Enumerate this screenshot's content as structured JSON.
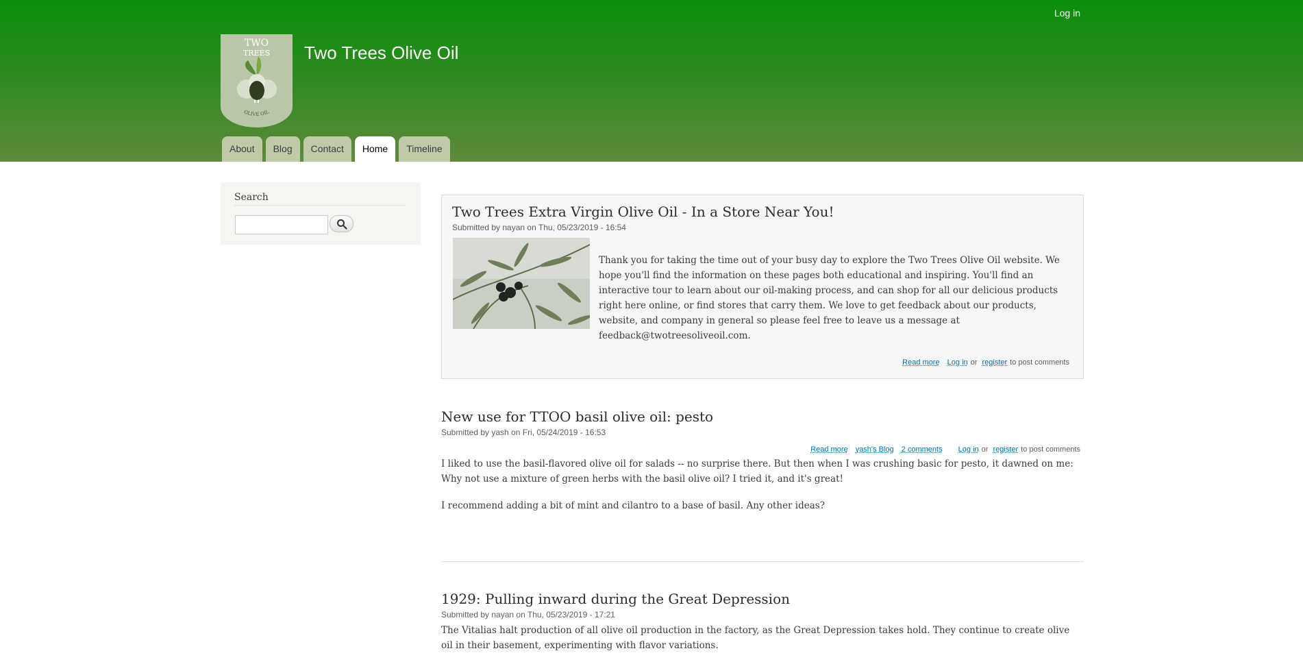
{
  "header": {
    "login_label": "Log in",
    "site_name": "Two Trees Olive Oil",
    "logo": {
      "line1": "TWO",
      "line2": "TREES",
      "arc_text": "OLIVE OIL"
    },
    "menu": [
      {
        "label": "About"
      },
      {
        "label": "Blog"
      },
      {
        "label": "Contact"
      },
      {
        "label": "Home",
        "active": true
      },
      {
        "label": "Timeline"
      }
    ]
  },
  "sidebar": {
    "search_title": "Search",
    "search_value": "",
    "search_button_icon": "magnifier-icon"
  },
  "articles": [
    {
      "title": "Two Trees Extra Virgin Olive Oil - In a Store Near You!",
      "submitted": "Submitted by nayan on Thu, 05/23/2019 - 16:54",
      "body": "Thank you for taking the time out of your busy day to explore the Two Trees Olive Oil website. We hope you'll find the information on these pages both educational and inspiring. You'll find an interactive tour to learn about our oil-making process, and can shop for all our delicious products right here online, or find stores that carry them. We love to get feedback about our products, website, and company in general so please feel free to leave us a message at feedback@twotreesoliveoil.com.",
      "read_more": "Read more",
      "login": "Log in",
      "or": "or",
      "register": "register",
      "to_post": "to post comments"
    },
    {
      "title": "New use for TTOO basil olive oil: pesto",
      "submitted": "Submitted by yash on Fri, 05/24/2019 - 16:53",
      "read_more": "Read more",
      "blog": "yash's Blog",
      "comments": "2 comments",
      "login": "Log in",
      "or": "or",
      "register": "register",
      "to_post": "to post comments",
      "para1": "I liked to use the basil-flavored olive oil for salads -- no surprise there. But then when I was crushing basic for pesto, it dawned on me: Why not use a mixture of green herbs with the basil olive oil? I tried it, and it's great!",
      "para2": "I recommend adding a bit of mint and cilantro to a base of basil. Any other ideas?"
    },
    {
      "title": "1929: Pulling inward during the Great Depression",
      "submitted": "Submitted by nayan on Thu, 05/23/2019 - 17:21",
      "body": "The Vitalias halt production of all olive oil production in the factory, as the Great Depression takes hold. They continue to create olive oil in their basement, experimenting with flavor variations."
    }
  ],
  "colors": {
    "header_top": "#0b8f0b",
    "header_bottom": "#5f8a3c",
    "tab": "#bfcba8",
    "link": "#0071b3"
  }
}
